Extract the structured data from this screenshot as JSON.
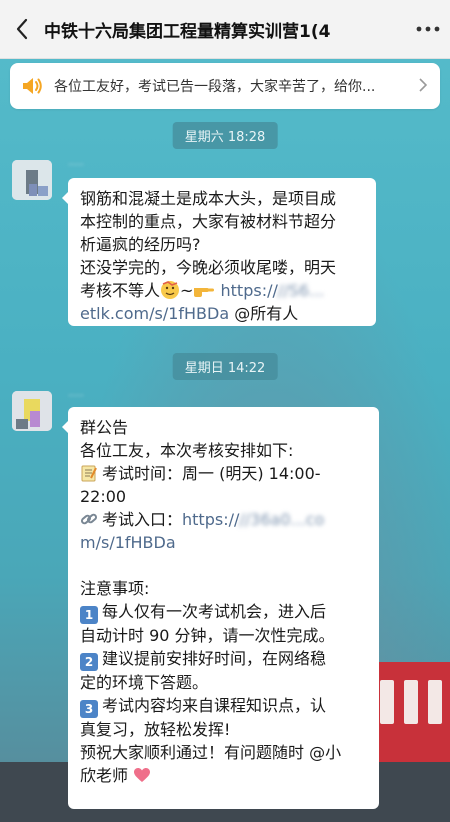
{
  "header": {
    "title": "中铁十六局集团工程量精算实训营1(4",
    "back_icon": "chevron-left-icon",
    "more_icon": "more-dots-icon"
  },
  "pinned_notice": {
    "text": "各位工友好，考试已告一段落，大家辛苦了，给你...",
    "icon": "speaker-icon"
  },
  "messages": [
    {
      "timestamp": "星期六 18:28",
      "lines": [
        "钢筋和混凝土是成本大头，是项目成",
        "本控制的重点，大家有被材料节超分",
        "析逼疯的经历吗?",
        "还没学完的，今晚必须收尾喽，明天"
      ],
      "line5_text": "考核不等人",
      "line5_tilde": "~",
      "link_part1": "https://",
      "link_part2": "etlk.com/s/1fHBDa",
      "mention": "@所有人"
    },
    {
      "timestamp": "星期日 14:22",
      "heading": "群公告",
      "intro": "各位工友，本次考核安排如下:",
      "exam_time_label": "考试时间：周一 (明天) 14:00-",
      "exam_time_end": "22:00",
      "exam_entry_label": "考试入口：",
      "exam_link_1": "https://",
      "exam_link_2": "m/s/1fHBDa",
      "notes_heading": "注意事项:",
      "note1_a": "每人仅有一次考试机会，进入后",
      "note1_b": "自动计时 90 分钟，请一次性完成。",
      "note2_a": "建议提前安排好时间，在网络稳",
      "note2_b": "定的环境下答题。",
      "note3_a": "考试内容均来自课程知识点，认",
      "note3_b": "真复习，放轻松发挥!",
      "closing_a": "预祝大家顺利通过！有问题随时 @小",
      "closing_b": "欣老师",
      "badge1": "1",
      "badge2": "2",
      "badge3": "3"
    }
  ],
  "colors": {
    "link": "#4f6a8c",
    "header_bg": "#f3f3f3",
    "chat_bg": "#4fb3c4",
    "bubble_bg": "#ffffff",
    "badge_blue": "#4c84c7",
    "speaker_orange": "#f5a623"
  }
}
